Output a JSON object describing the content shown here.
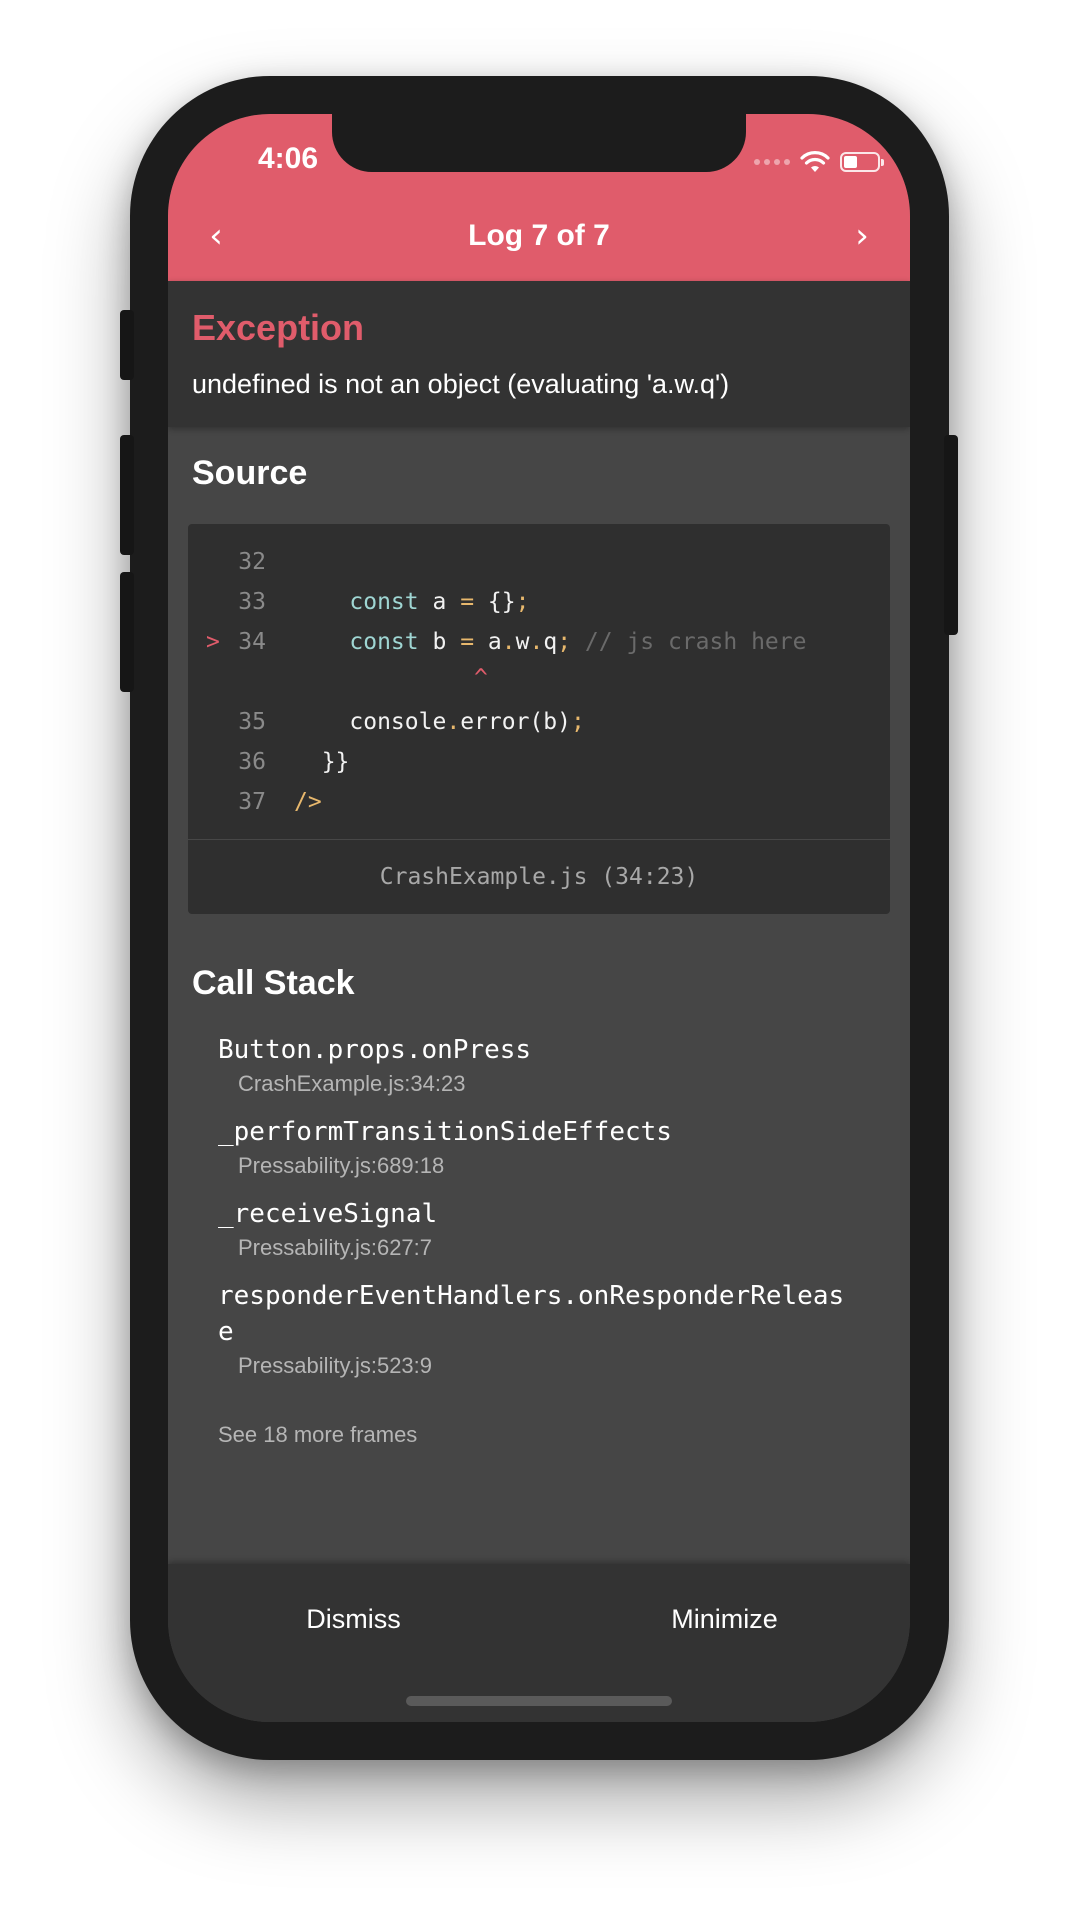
{
  "status_bar": {
    "time": "4:06",
    "battery_level": 0.4
  },
  "header": {
    "title": "Log 7 of 7",
    "prev_icon": "‹",
    "next_icon": "›",
    "color": "#e05c6b"
  },
  "exception": {
    "title": "Exception",
    "message": "undefined is not an object (evaluating 'a.w.q')"
  },
  "source": {
    "heading": "Source",
    "lines": [
      {
        "number": "32",
        "marker": "",
        "code": ""
      },
      {
        "number": "33",
        "marker": "",
        "code": "    const a = {};"
      },
      {
        "number": "34",
        "marker": ">",
        "code": "    const b = a.w.q; // js crash here"
      },
      {
        "number": "",
        "marker": "",
        "code": "             ^"
      },
      {
        "number": "35",
        "marker": "",
        "code": "    console.error(b);"
      },
      {
        "number": "36",
        "marker": "",
        "code": "  }}"
      },
      {
        "number": "37",
        "marker": "",
        "code": "/>"
      }
    ],
    "file_label": "CrashExample.js (34:23)"
  },
  "call_stack": {
    "heading": "Call Stack",
    "frames": [
      {
        "name": "Button.props.onPress",
        "location": "CrashExample.js:34:23"
      },
      {
        "name": "_performTransitionSideEffects",
        "location": "Pressability.js:689:18"
      },
      {
        "name": "_receiveSignal",
        "location": "Pressability.js:627:7"
      },
      {
        "name": "responderEventHandlers.onResponderRelease",
        "location": "Pressability.js:523:9"
      }
    ],
    "more_frames": "See 18 more frames"
  },
  "footer": {
    "dismiss": "Dismiss",
    "minimize": "Minimize"
  }
}
